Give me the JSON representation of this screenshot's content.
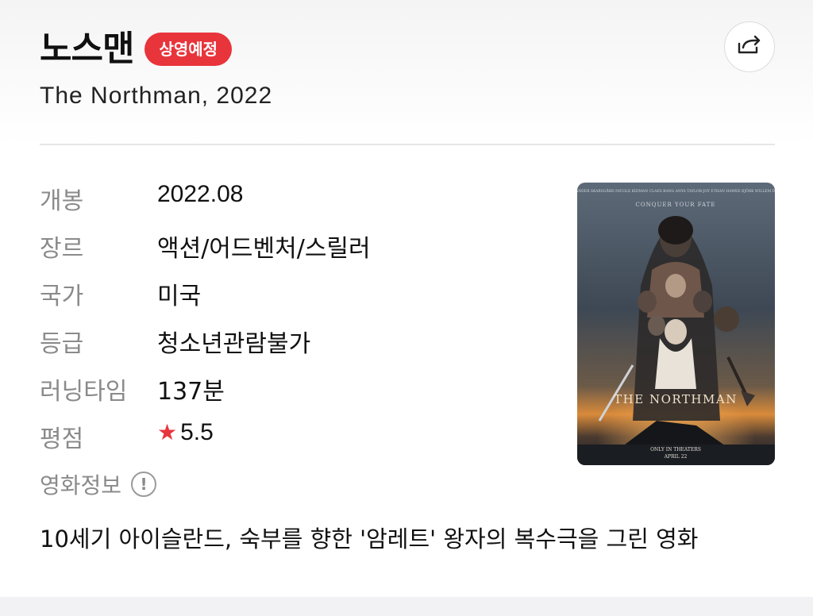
{
  "header": {
    "title": "노스맨",
    "status_badge": "상영예정",
    "subtitle": "The Northman, 2022",
    "share_icon": "share-icon"
  },
  "details": {
    "release_label": "개봉",
    "release_value": "2022.08",
    "genre_label": "장르",
    "genre_value": "액션/어드벤처/스릴러",
    "country_label": "국가",
    "country_value": "미국",
    "rating_label": "등급",
    "rating_value": "청소년관람불가",
    "runtime_label": "러닝타임",
    "runtime_value": "137분",
    "score_label": "평점",
    "score_icon": "star-icon",
    "score_value": "5.5"
  },
  "movie_info": {
    "label": "영화정보",
    "icon": "info-icon",
    "description": "10세기 아이슬란드, 숙부를 향한 '암레트' 왕자의 복수극을 그린 영화"
  },
  "poster": {
    "tagline": "CONQUER YOUR FATE",
    "title": "THE NORTHMAN",
    "credits": "ALEXANDER SKARSGÅRD  NICOLE KIDMAN  CLAES BANG  ANYA TAYLOR-JOY  ETHAN HAWKE  BJÖRK  WILLEM DAFOE",
    "release_line": "ONLY IN THEATERS",
    "release_date": "APRIL 22"
  },
  "colors": {
    "accent": "#e8343b",
    "label_gray": "#8a8a8a",
    "divider": "#e6e6e6"
  }
}
